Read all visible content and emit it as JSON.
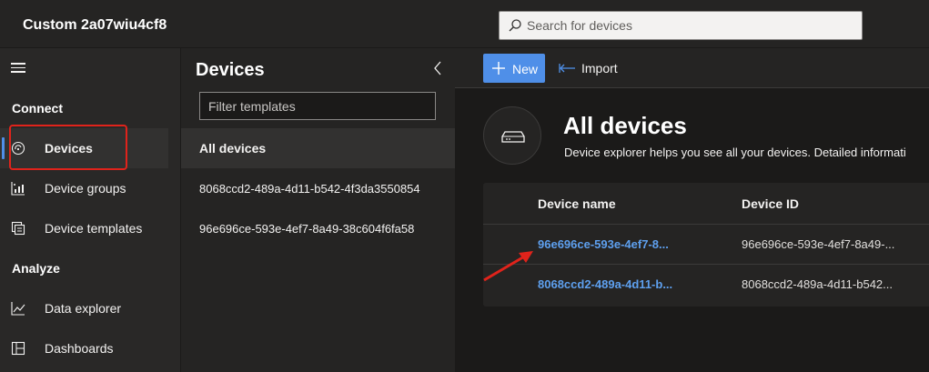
{
  "app": {
    "title": "Custom 2a07wiu4cf8"
  },
  "search": {
    "placeholder": "Search for devices"
  },
  "nav": {
    "sections": [
      {
        "title": "Connect"
      },
      {
        "title": "Analyze"
      }
    ],
    "items": [
      {
        "label": "Devices",
        "icon": "devices-icon",
        "active": true
      },
      {
        "label": "Device groups",
        "icon": "device-groups-icon"
      },
      {
        "label": "Device templates",
        "icon": "device-templates-icon"
      },
      {
        "label": "Data explorer",
        "icon": "data-explorer-icon"
      },
      {
        "label": "Dashboards",
        "icon": "dashboards-icon"
      }
    ]
  },
  "templates_panel": {
    "title": "Devices",
    "filter_placeholder": "Filter templates",
    "items": [
      {
        "label": "All devices",
        "active": true
      },
      {
        "label": "8068ccd2-489a-4d11-b542-4f3da3550854"
      },
      {
        "label": "96e696ce-593e-4ef7-8a49-38c604f6fa58"
      }
    ]
  },
  "commands": {
    "new_label": "New",
    "import_label": "Import"
  },
  "main": {
    "title": "All devices",
    "description": "Device explorer helps you see all your devices. Detailed informati"
  },
  "table": {
    "columns": [
      "Device name",
      "Device ID"
    ],
    "rows": [
      {
        "name": "96e696ce-593e-4ef7-8...",
        "id": "96e696ce-593e-4ef7-8a49-..."
      },
      {
        "name": "8068ccd2-489a-4d11-b...",
        "id": "8068ccd2-489a-4d11-b542..."
      }
    ]
  },
  "colors": {
    "accent": "#4f8fe8",
    "link": "#5ea0ef",
    "annotation": "#e0231b"
  }
}
